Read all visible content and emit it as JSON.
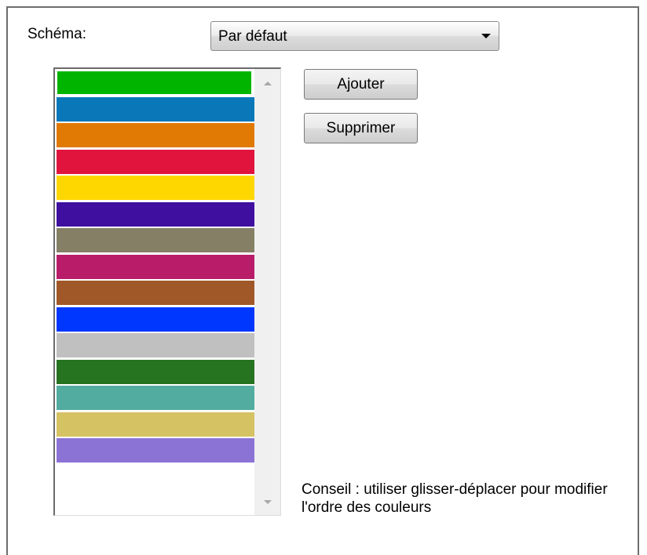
{
  "scheme": {
    "label": "Schéma:",
    "selected": "Par défaut"
  },
  "buttons": {
    "add": "Ajouter",
    "remove": "Supprimer"
  },
  "colors": [
    "#00b400",
    "#0a78b8",
    "#e07a05",
    "#e0143c",
    "#ffd700",
    "#3f0fa0",
    "#857f66",
    "#b91c68",
    "#a05828",
    "#0037ff",
    "#c0c0c0",
    "#267320",
    "#52aca0",
    "#d5c263",
    "#8b73d5"
  ],
  "hint": "Conseil : utiliser glisser-déplacer pour modifier l'ordre des couleurs"
}
